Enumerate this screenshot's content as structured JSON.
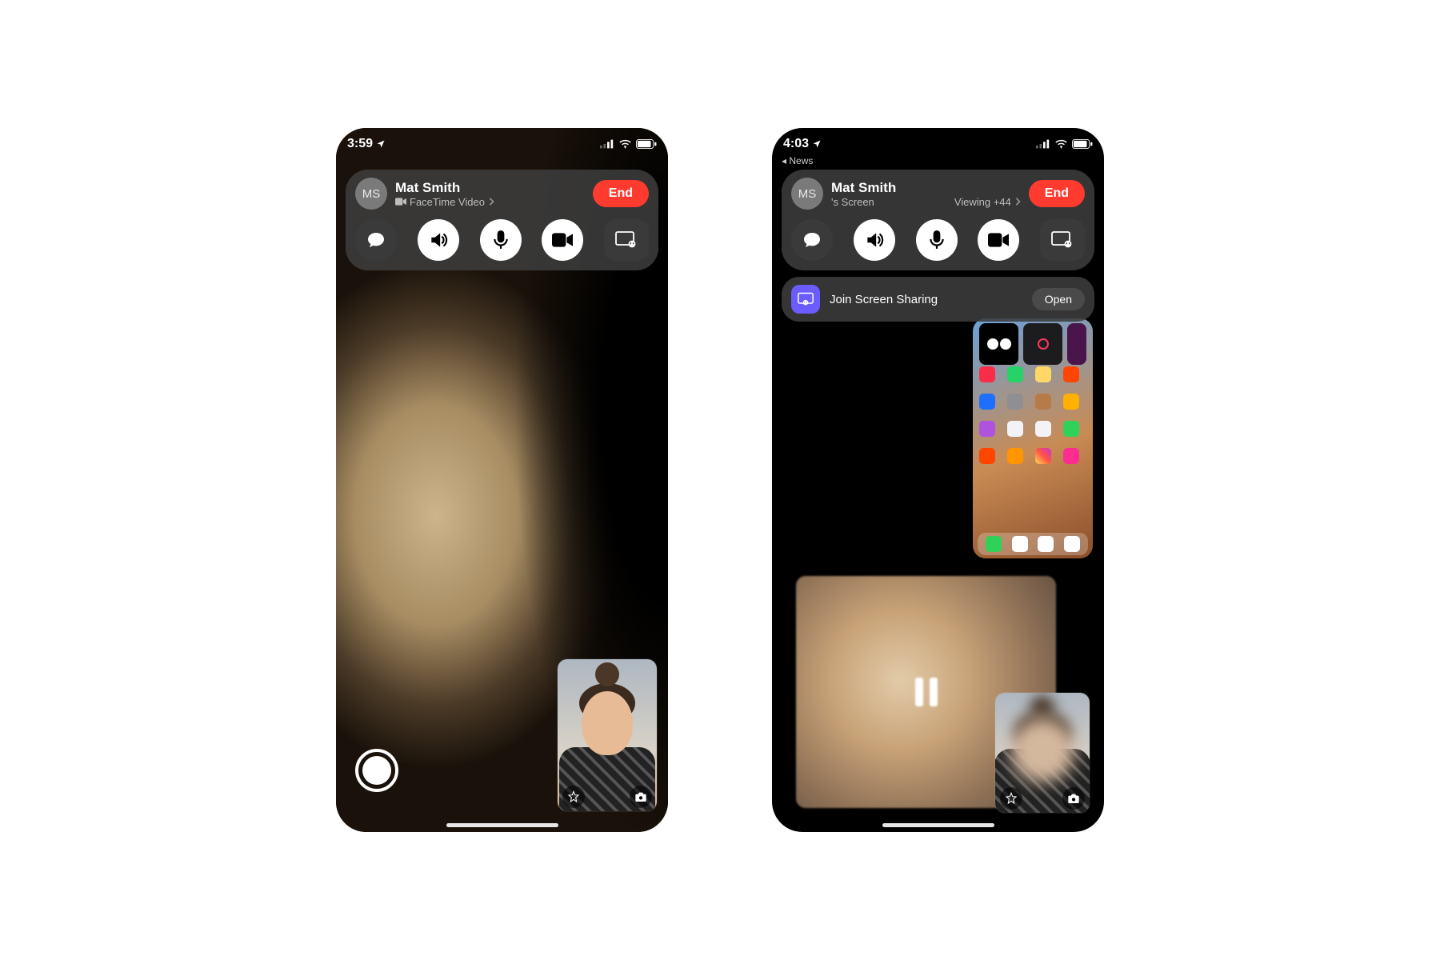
{
  "phoneA": {
    "status": {
      "time": "3:59"
    },
    "caller": {
      "initials": "MS",
      "name": "Mat Smith",
      "subtitle": "FaceTime Video"
    },
    "end_label": "End"
  },
  "phoneB": {
    "status": {
      "time": "4:03"
    },
    "back_app": "◂ News",
    "caller": {
      "initials": "MS",
      "name": "Mat Smith",
      "sub_left": "'s Screen",
      "sub_right": "Viewing +44"
    },
    "end_label": "End",
    "share": {
      "text": "Join Screen Sharing",
      "open": "Open"
    }
  }
}
